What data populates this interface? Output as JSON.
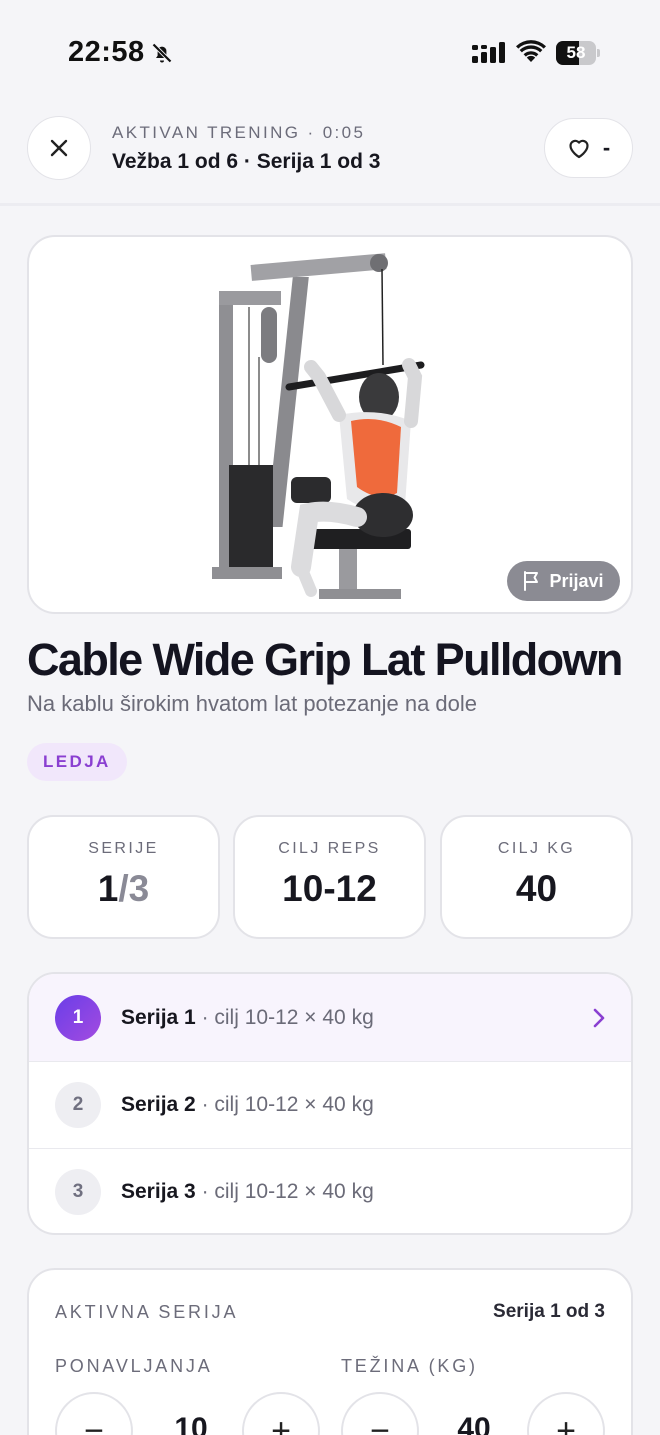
{
  "status_bar": {
    "time": "22:58",
    "battery": "58",
    "battery_level": 0.58
  },
  "header": {
    "workout_status": "AKTIVAN TRENING · 0:05",
    "workout_progress": "Vežba 1 od 6 · Serija 1 od 3",
    "favorite_count": "-"
  },
  "exercise": {
    "report_label": "Prijavi",
    "title": "Cable Wide Grip Lat Pulldown",
    "subtitle": "Na kablu širokim hvatom lat potezanje na dole",
    "muscle_tag": "LEDJA",
    "tag_color": "#8a3fd1"
  },
  "stats": {
    "sets_label": "SERIJE",
    "sets_current": "1",
    "sets_total": "/3",
    "reps_label": "CILJ REPS",
    "reps_value": "10-12",
    "kg_label": "CILJ KG",
    "kg_value": "40"
  },
  "sets": [
    {
      "number": "1",
      "name": "Serija 1",
      "target": " · cilj 10-12 × 40 kg",
      "active": true
    },
    {
      "number": "2",
      "name": "Serija 2",
      "target": " · cilj 10-12 × 40 kg",
      "active": false
    },
    {
      "number": "3",
      "name": "Serija 3",
      "target": " · cilj 10-12 × 40 kg",
      "active": false
    }
  ],
  "active_set": {
    "label": "AKTIVNA SERIJA",
    "progress": "Serija 1 od 3",
    "reps_label": "PONAVLJANJA",
    "reps_value": "10",
    "weight_label": "TEŽINA (KG)",
    "weight_value": "40",
    "minus": "−",
    "plus": "+"
  },
  "accent": "#7b3fe4"
}
